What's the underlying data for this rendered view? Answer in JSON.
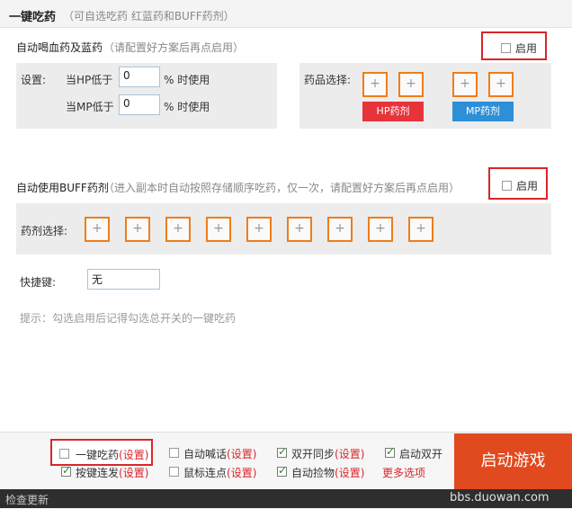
{
  "header": {
    "title": "一键吃药",
    "subtitle": "（可自选吃药 红蓝药和BUFF药剂）"
  },
  "potion_section": {
    "title": "自动喝血药及蓝药",
    "hint": "（请配置好方案后再点启用）",
    "enable_label": "启用",
    "settings_label": "设置:",
    "hp_label": "当HP低于",
    "hp_value": "0",
    "hp_suffix": "% 时使用",
    "mp_label": "当MP低于",
    "mp_value": "0",
    "mp_suffix": "% 时使用",
    "select_label": "药品选择:",
    "plus": "+",
    "hp_potion_label": "HP药剂",
    "mp_potion_label": "MP药剂"
  },
  "buff_section": {
    "title": "自动使用BUFF药剂",
    "hint": "（进入副本时自动按照存储顺序吃药，仅一次，请配置好方案后再点启用）",
    "enable_label": "启用",
    "select_label": "药剂选择:",
    "plus": "+",
    "hotkey_label": "快捷键:",
    "hotkey_value": "无",
    "tip": "提示：勾选启用后记得勾选总开关的一键吃药"
  },
  "footer": {
    "options": [
      {
        "label": "一键吃药",
        "link": "(设置)",
        "checked": false
      },
      {
        "label": "自动喊话",
        "link": "(设置)",
        "checked": false
      },
      {
        "label": "双开同步",
        "link": "(设置)",
        "checked": true
      },
      {
        "label": "启动双开",
        "link": "",
        "checked": true
      },
      {
        "label": "按键连发",
        "link": "(设置)",
        "checked": true
      },
      {
        "label": "鼠标连点",
        "link": "(设置)",
        "checked": false
      },
      {
        "label": "自动捡物",
        "link": "(设置)",
        "checked": true
      }
    ],
    "more": "更多选项",
    "start_button": "启动游戏",
    "check_update": "检查更新",
    "watermark": "bbs.duowan.com"
  }
}
